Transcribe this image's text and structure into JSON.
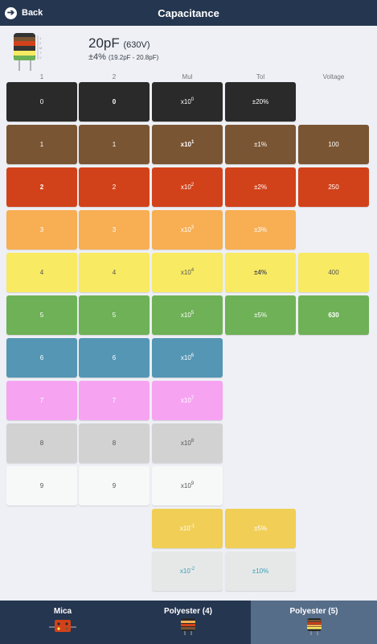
{
  "header": {
    "back_label": "Back",
    "title": "Capacitance"
  },
  "value": {
    "main": "20pF",
    "voltage": "(630V)",
    "tolerance": "±4%",
    "range": "(19.2pF - 20.8pF)"
  },
  "columns": [
    "1",
    "2",
    "Mul",
    "Tol",
    "Voltage"
  ],
  "rows": [
    {
      "color": "#2a2a2a",
      "text_color": "#ffffff",
      "c1": "0",
      "c2": "0",
      "mul_base": "x10",
      "mul_exp": "0",
      "tol": "±20%",
      "volt": ""
    },
    {
      "color": "#7a5533",
      "text_color": "#ffffff",
      "c1": "1",
      "c2": "1",
      "mul_base": "x10",
      "mul_exp": "1",
      "tol": "±1%",
      "volt": "100"
    },
    {
      "color": "#d2421a",
      "text_color": "#ffffff",
      "c1": "2",
      "c2": "2",
      "mul_base": "x10",
      "mul_exp": "2",
      "tol": "±2%",
      "volt": "250"
    },
    {
      "color": "#f8ae53",
      "text_color": "#ffffff",
      "c1": "3",
      "c2": "3",
      "mul_base": "x10",
      "mul_exp": "3",
      "tol": "±3%",
      "volt": ""
    },
    {
      "color": "#f8ea62",
      "text_color": "#555555",
      "c1": "4",
      "c2": "4",
      "mul_base": "x10",
      "mul_exp": "4",
      "tol": "±4%",
      "volt": "400"
    },
    {
      "color": "#6eb156",
      "text_color": "#ffffff",
      "c1": "5",
      "c2": "5",
      "mul_base": "x10",
      "mul_exp": "5",
      "tol": "±5%",
      "volt": "630"
    },
    {
      "color": "#5496b4",
      "text_color": "#ffffff",
      "c1": "6",
      "c2": "6",
      "mul_base": "x10",
      "mul_exp": "6",
      "tol": "",
      "volt": ""
    },
    {
      "color": "#f6a4f1",
      "text_color": "#ffffff",
      "c1": "7",
      "c2": "7",
      "mul_base": "x10",
      "mul_exp": "7",
      "tol": "",
      "volt": ""
    },
    {
      "color": "#d2d2d2",
      "text_color": "#555555",
      "c1": "8",
      "c2": "8",
      "mul_base": "x10",
      "mul_exp": "8",
      "tol": "",
      "volt": ""
    },
    {
      "color": "#f7f8f8",
      "text_color": "#555555",
      "c1": "9",
      "c2": "9",
      "mul_base": "x10",
      "mul_exp": "9",
      "tol": "",
      "volt": ""
    }
  ],
  "extra_rows": [
    {
      "color": "#f1ce55",
      "text_color": "#ffffff",
      "mul_base": "x10",
      "mul_exp": "-1",
      "tol": "±5%"
    },
    {
      "color": "#e6e8e8",
      "text_color": "#3a9fb8",
      "mul_base": "x10",
      "mul_exp": "-2",
      "tol": "±10%"
    }
  ],
  "selection": {
    "c1": "2",
    "c2": "0",
    "mul": "1",
    "tol": "±4%",
    "volt": "630"
  },
  "tabs": [
    {
      "label": "Mica",
      "icon": "mica-capacitor-icon",
      "active": false
    },
    {
      "label": "Polyester (4)",
      "icon": "polyester-4-band-icon",
      "active": false
    },
    {
      "label": "Polyester (5)",
      "icon": "polyester-5-band-icon",
      "active": true
    }
  ]
}
